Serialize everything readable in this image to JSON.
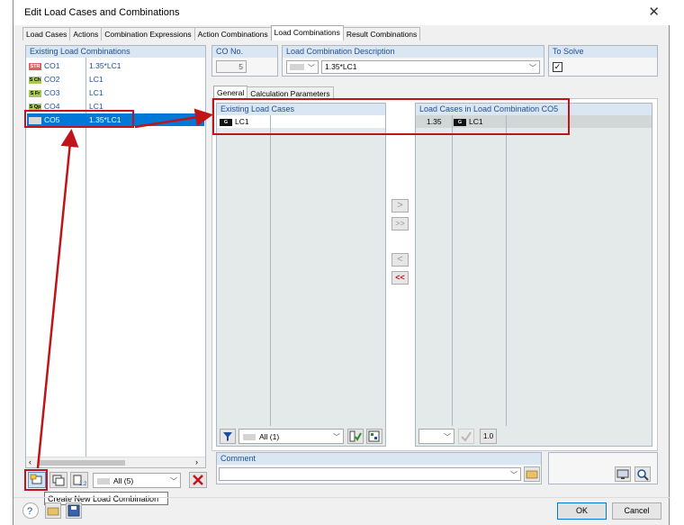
{
  "window": {
    "title": "Edit Load Cases and Combinations",
    "close": "✕"
  },
  "tabs": [
    {
      "label": "Load Cases"
    },
    {
      "label": "Actions"
    },
    {
      "label": "Combination Expressions"
    },
    {
      "label": "Action Combinations"
    },
    {
      "label": "Load Combinations"
    },
    {
      "label": "Result Combinations"
    }
  ],
  "left_list": {
    "header": "Existing Load Combinations",
    "rows": [
      {
        "tag": "STR",
        "tag_color": "#e06060",
        "id": "CO1",
        "desc": "1.35*LC1"
      },
      {
        "tag": "S Ch",
        "tag_color": "#a8c85a",
        "id": "CO2",
        "desc": "LC1"
      },
      {
        "tag": "S Fr",
        "tag_color": "#a8c85a",
        "id": "CO3",
        "desc": "LC1"
      },
      {
        "tag": "S Qp",
        "tag_color": "#a8c85a",
        "id": "CO4",
        "desc": "LC1"
      },
      {
        "tag": "",
        "tag_color": "#d8d8d8",
        "id": "CO5",
        "desc": "1.35*LC1"
      }
    ],
    "filter_value": "All (5)",
    "tooltip": "Create New Load Combination"
  },
  "co_no": {
    "label": "CO No.",
    "value": "5"
  },
  "description": {
    "label": "Load Combination Description",
    "value": "1.35*LC1"
  },
  "to_solve": {
    "label": "To Solve",
    "checked": "✓"
  },
  "subtabs": [
    {
      "label": "General"
    },
    {
      "label": "Calculation Parameters"
    }
  ],
  "existing_cases": {
    "header": "Existing Load Cases",
    "rows": [
      {
        "tag": "G",
        "id": "LC1"
      }
    ],
    "filter_value": "All (1)"
  },
  "combo_cases": {
    "header": "Load Cases in Load Combination CO5",
    "rows": [
      {
        "factor": "1.35",
        "tag": "G",
        "id": "LC1"
      }
    ],
    "factor_button": "1.0"
  },
  "transfer_buttons": {
    "add": ">",
    "add_all": ">>",
    "remove": "<",
    "remove_all": "<<"
  },
  "comment": {
    "label": "Comment",
    "value": ""
  },
  "footer": {
    "ok": "OK",
    "cancel": "Cancel"
  },
  "colors": {
    "selection": "#0078d7",
    "annotation": "#c0141a",
    "header_bg": "#dbe6f3"
  }
}
